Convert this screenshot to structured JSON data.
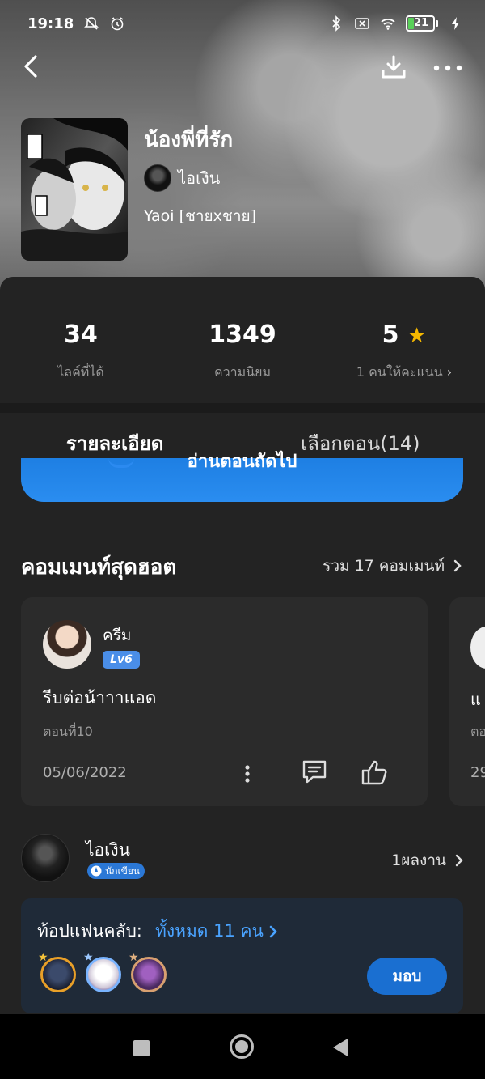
{
  "status_bar": {
    "time": "19:18",
    "battery": "21",
    "icons": [
      "mute-alarm-icon",
      "alarm-icon",
      "bluetooth-icon",
      "sim-off-icon",
      "wifi-icon",
      "battery-icon",
      "charging-icon"
    ]
  },
  "top_nav": {
    "icons": [
      "back-icon",
      "download-icon",
      "more-icon"
    ]
  },
  "book": {
    "title": "น้องพี่ที่รัก",
    "author": "ไอเงิน",
    "genre": "Yaoi [ชายxชาย]"
  },
  "stats": [
    {
      "value": "34",
      "label": "ไลค์ที่ได้"
    },
    {
      "value": "1349",
      "label": "ความนิยม"
    },
    {
      "value": "5",
      "label": "1 คนให้คะแนน"
    }
  ],
  "tabs": [
    {
      "label": "รายละเอียด",
      "active": true
    },
    {
      "label": "เลือกตอน(14)",
      "active": false
    }
  ],
  "read_button": {
    "label": "อ่านตอนถัดไป"
  },
  "hot_comments": {
    "title": "คอมเมนท์สุดฮอต",
    "total": "รวม 17 คอมเมนท์",
    "items": [
      {
        "user": "ครีม",
        "level": "Lv6",
        "text": "รีบต่อน้าาาแอด",
        "episode": "ตอนที่10",
        "date": "05/06/2022"
      },
      {
        "text": "แ",
        "episode": "ตอ",
        "date": "29"
      }
    ]
  },
  "writer": {
    "name": "ไอเงิน",
    "badge": "นักเขียน",
    "works": "1ผลงาน"
  },
  "fan_club": {
    "title": "ท้อปแฟนคลับ:",
    "count": "ทั้งหมด 11 คน",
    "give_label": "มอบ"
  },
  "colors": {
    "accent": "#2b8af0",
    "star": "#f5b800",
    "panel": "#232323"
  }
}
